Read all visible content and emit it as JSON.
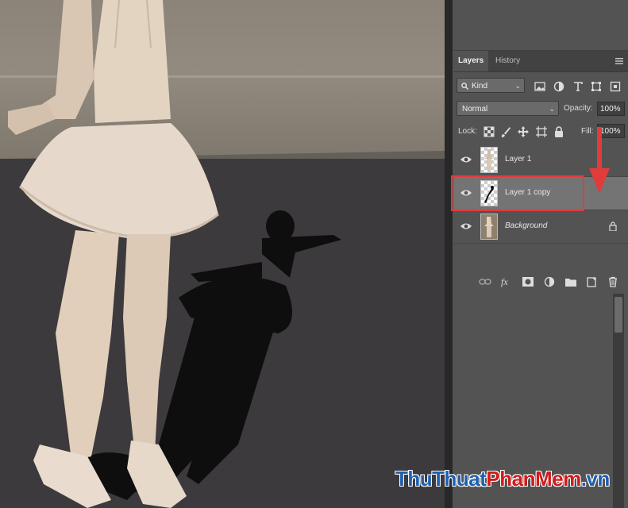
{
  "canvas": {
    "description_icon": "ballerina-photo"
  },
  "layers_panel": {
    "tabs": [
      {
        "label": "Layers",
        "active": true
      },
      {
        "label": "History",
        "active": false
      }
    ],
    "filter": {
      "label": "Kind"
    },
    "blend_mode": {
      "value": "Normal"
    },
    "opacity": {
      "label": "Opacity:",
      "value": "100%"
    },
    "lock": {
      "label": "Lock:"
    },
    "fill": {
      "label": "Fill:",
      "value": "100%"
    },
    "layers": [
      {
        "name": "Layer 1",
        "selected": false,
        "visible": true
      },
      {
        "name": "Layer 1 copy",
        "selected": true,
        "visible": true
      },
      {
        "name": "Background",
        "selected": false,
        "visible": true,
        "locked": true
      }
    ]
  },
  "watermark": {
    "part1": "ThuThuat",
    "part2": "PhanMem",
    "part3": ".vn"
  },
  "colors": {
    "highlight": "#e23b3b",
    "arrow": "#e23b3b",
    "panel_bg": "#535353"
  }
}
